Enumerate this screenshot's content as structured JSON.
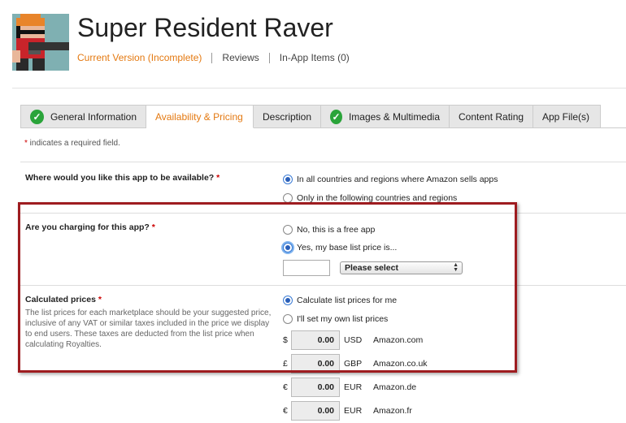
{
  "app": {
    "title": "Super Resident Raver",
    "nav": {
      "current_version": "Current Version (Incomplete)",
      "reviews": "Reviews",
      "in_app_items": "In-App Items (0)"
    }
  },
  "tabs": [
    {
      "label": "General Information",
      "completed": true
    },
    {
      "label": "Availability & Pricing",
      "active": true
    },
    {
      "label": "Description"
    },
    {
      "label": "Images & Multimedia",
      "completed": true
    },
    {
      "label": "Content Rating"
    },
    {
      "label": "App File(s)"
    }
  ],
  "required_note": {
    "star": "*",
    "text": " indicates a required field."
  },
  "availability": {
    "question": "Where would you like this app to be available?",
    "star": "*",
    "options": [
      {
        "label": "In all countries and regions where Amazon sells apps",
        "selected": true
      },
      {
        "label": "Only in the following countries and regions",
        "selected": false
      }
    ]
  },
  "charging": {
    "question": "Are you charging for this app?",
    "star": "*",
    "options": [
      {
        "label": "No, this is a free app",
        "selected": false
      },
      {
        "label": "Yes, my base list price is...",
        "selected": true
      }
    ],
    "price_value": "",
    "currency_select": "Please select"
  },
  "calculated": {
    "question": "Calculated prices",
    "star": "*",
    "description": "The list prices for each marketplace should be your suggested price, inclusive of any VAT or similar taxes included in the price we display to end users. These taxes are deducted from the list price when calculating Royalties.",
    "options": [
      {
        "label": "Calculate list prices for me",
        "selected": true
      },
      {
        "label": "I'll set my own list prices",
        "selected": false
      }
    ],
    "prices": [
      {
        "symbol": "$",
        "amount": "0.00",
        "currency": "USD",
        "market": "Amazon.com"
      },
      {
        "symbol": "£",
        "amount": "0.00",
        "currency": "GBP",
        "market": "Amazon.co.uk"
      },
      {
        "symbol": "€",
        "amount": "0.00",
        "currency": "EUR",
        "market": "Amazon.de"
      },
      {
        "symbol": "€",
        "amount": "0.00",
        "currency": "EUR",
        "market": "Amazon.fr"
      }
    ]
  },
  "colors": {
    "accent": "#e47911",
    "check": "#2aa43a",
    "highlight_border": "#9e1c20"
  },
  "icons": {
    "tab_complete": "check-circle-icon",
    "select": "up-down-arrows-icon"
  }
}
